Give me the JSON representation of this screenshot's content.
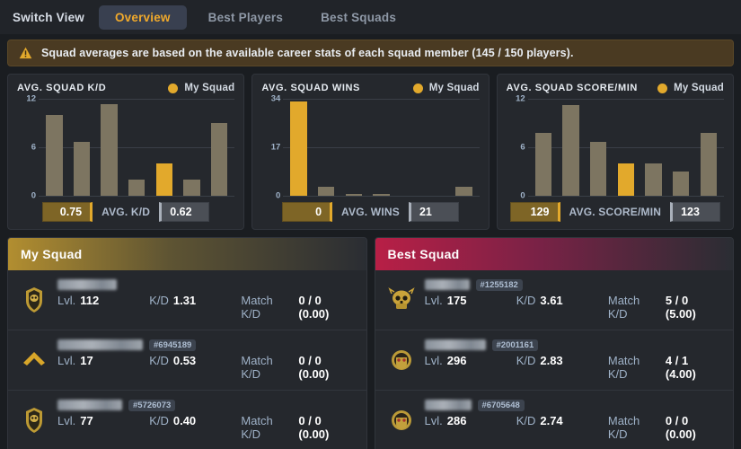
{
  "topbar": {
    "switch_view_label": "Switch View",
    "tabs": [
      {
        "label": "Overview",
        "active": true
      },
      {
        "label": "Best Players",
        "active": false
      },
      {
        "label": "Best Squads",
        "active": false
      }
    ]
  },
  "alert": {
    "icon": "warning-triangle-icon",
    "text": "Squad averages are based on the available career stats of each squad member (145 / 150 players)."
  },
  "colors": {
    "accent_gold": "#e2a92c",
    "bar_gray": "#7d7561",
    "panel_bg": "#25282d",
    "alert_bg": "#4a3a22",
    "my_squad_header": "#b28e30",
    "best_squad_header": "#b81f46"
  },
  "charts": [
    {
      "title": "AVG. SQUAD K/D",
      "legend_label": "My Squad",
      "footer_label": "AVG. K/D",
      "my_value": "0.75",
      "avg_value": "0.62",
      "chart_data": {
        "type": "bar",
        "title": "AVG. SQUAD K/D",
        "xlabel": "",
        "ylabel": "",
        "ylim": [
          0,
          12
        ],
        "yticks": [
          0,
          6,
          12
        ],
        "grid": true,
        "legend": [
          "My Squad"
        ],
        "legend_position": "top-right",
        "categories": [
          "1",
          "2",
          "3",
          "4",
          "5",
          "6",
          "7"
        ],
        "values": [
          10.0,
          6.7,
          11.3,
          2.0,
          4.0,
          2.0,
          9.0
        ],
        "highlight_index": 4,
        "highlight_color": "#e2a92c"
      }
    },
    {
      "title": "AVG. SQUAD WINS",
      "legend_label": "My Squad",
      "footer_label": "AVG. WINS",
      "my_value": "0",
      "avg_value": "21",
      "chart_data": {
        "type": "bar",
        "title": "AVG. SQUAD WINS",
        "xlabel": "",
        "ylabel": "",
        "ylim": [
          0,
          34
        ],
        "yticks": [
          0,
          17,
          34
        ],
        "grid": true,
        "legend": [
          "My Squad"
        ],
        "legend_position": "top-right",
        "categories": [
          "1",
          "2",
          "3",
          "4",
          "5",
          "6",
          "7"
        ],
        "values": [
          33.0,
          3.0,
          0.5,
          0.5,
          0,
          0,
          3.0
        ],
        "highlight_index": 0,
        "highlight_color": "#e2a92c"
      }
    },
    {
      "title": "AVG. SQUAD SCORE/MIN",
      "legend_label": "My Squad",
      "footer_label": "AVG. SCORE/MIN",
      "my_value": "129",
      "avg_value": "123",
      "chart_data": {
        "type": "bar",
        "title": "AVG. SQUAD SCORE/MIN",
        "xlabel": "",
        "ylabel": "",
        "ylim": [
          0,
          12
        ],
        "yticks": [
          0,
          6,
          12
        ],
        "grid": true,
        "legend": [
          "My Squad"
        ],
        "legend_position": "top-right",
        "categories": [
          "1",
          "2",
          "3",
          "4",
          "5",
          "6",
          "7"
        ],
        "values": [
          7.8,
          11.2,
          6.7,
          4.0,
          4.0,
          3.0,
          7.8
        ],
        "highlight_index": 3,
        "highlight_color": "#e2a92c"
      }
    }
  ],
  "panels": [
    {
      "title": "My Squad",
      "theme": "mine",
      "rows": [
        {
          "emblem": "squad-emblem-icon",
          "name_redacted": true,
          "name_width": 66,
          "player_id": "",
          "level_key": "Lvl.",
          "level_value": "112",
          "kd_key": "K/D",
          "kd_value": "1.31",
          "match_key": "Match K/D",
          "match_value": "0 / 0 (0.00)"
        },
        {
          "emblem": "rank-chevron-icon",
          "name_redacted": true,
          "name_width": 95,
          "player_id": "#6945189",
          "level_key": "Lvl.",
          "level_value": "17",
          "kd_key": "K/D",
          "kd_value": "0.53",
          "match_key": "Match K/D",
          "match_value": "0 / 0 (0.00)"
        },
        {
          "emblem": "squad-emblem-icon",
          "name_redacted": true,
          "name_width": 72,
          "player_id": "#5726073",
          "level_key": "Lvl.",
          "level_value": "77",
          "kd_key": "K/D",
          "kd_value": "0.40",
          "match_key": "Match K/D",
          "match_value": "0 / 0 (0.00)"
        }
      ]
    },
    {
      "title": "Best Squad",
      "theme": "best",
      "rows": [
        {
          "emblem": "skull-emblem-icon",
          "name_redacted": true,
          "name_width": 50,
          "player_id": "#1255182",
          "level_key": "Lvl.",
          "level_value": "175",
          "kd_key": "K/D",
          "kd_value": "3.61",
          "match_key": "Match K/D",
          "match_value": "5 / 0 (5.00)"
        },
        {
          "emblem": "crest-emblem-icon",
          "name_redacted": true,
          "name_width": 68,
          "player_id": "#2001161",
          "level_key": "Lvl.",
          "level_value": "296",
          "kd_key": "K/D",
          "kd_value": "2.83",
          "match_key": "Match K/D",
          "match_value": "4 / 1 (4.00)"
        },
        {
          "emblem": "crest-emblem-icon",
          "name_redacted": true,
          "name_width": 52,
          "player_id": "#6705648",
          "level_key": "Lvl.",
          "level_value": "286",
          "kd_key": "K/D",
          "kd_value": "2.74",
          "match_key": "Match K/D",
          "match_value": "0 / 0 (0.00)"
        }
      ]
    }
  ]
}
